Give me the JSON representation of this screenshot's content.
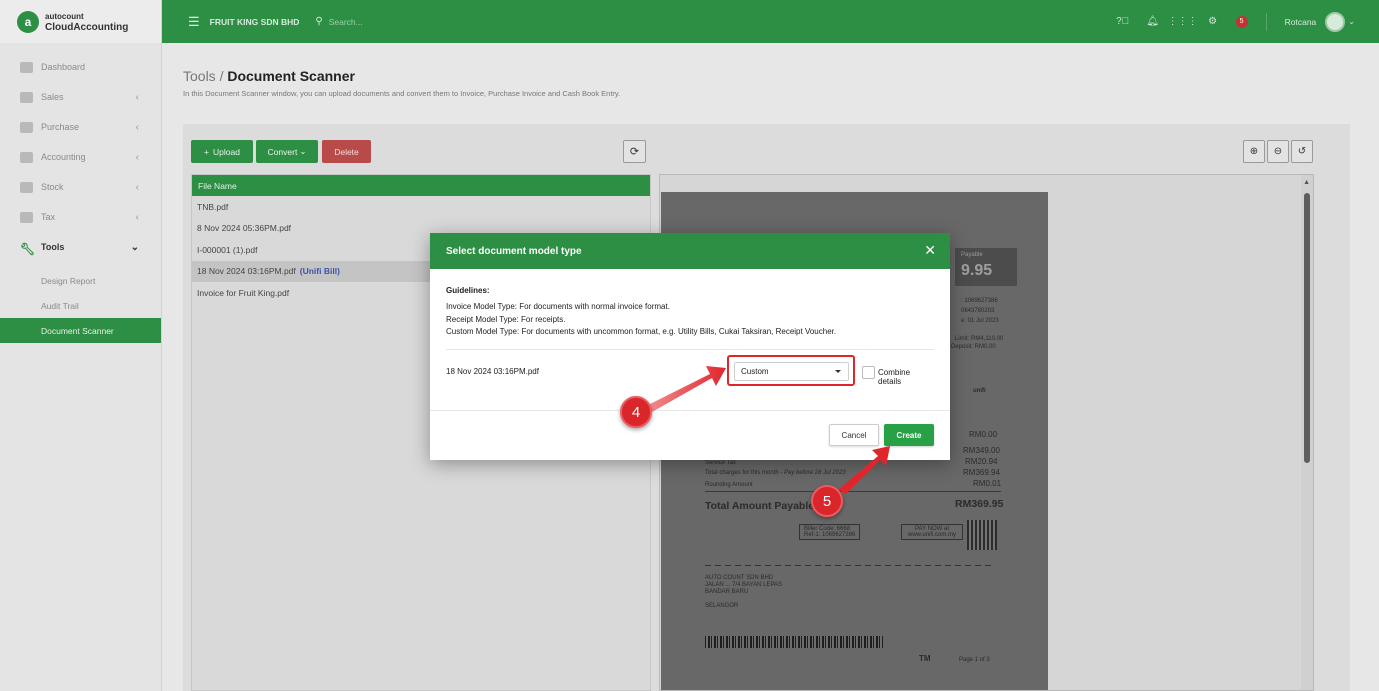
{
  "brand": {
    "logo_letter": "a",
    "sub": "autocount",
    "name": "CloudAccounting"
  },
  "topbar": {
    "company": "FRUIT KING SDN BHD",
    "search_placeholder": "Search...",
    "notification_count": "5",
    "user": "Rotcana"
  },
  "sidebar": {
    "items": [
      {
        "label": "Dashboard"
      },
      {
        "label": "Sales"
      },
      {
        "label": "Purchase"
      },
      {
        "label": "Accounting"
      },
      {
        "label": "Stock"
      },
      {
        "label": "Tax"
      },
      {
        "label": "Tools"
      }
    ],
    "sub_items": [
      {
        "label": "Design Report"
      },
      {
        "label": "Audit Trail"
      },
      {
        "label": "Document Scanner"
      }
    ]
  },
  "page": {
    "crumb": "Tools",
    "title": "Document Scanner",
    "description": "In this Document Scanner window, you can upload documents and convert them to Invoice, Purchase Invoice and Cash Book Entry."
  },
  "toolbar": {
    "upload": "Upload",
    "convert": "Convert",
    "delete": "Delete"
  },
  "file_table": {
    "header": "File Name",
    "rows": [
      {
        "name": "TNB.pdf",
        "tag": ""
      },
      {
        "name": "8 Nov 2024 05:36PM.pdf",
        "tag": ""
      },
      {
        "name": "I-000001 (1).pdf",
        "tag": ""
      },
      {
        "name": "18 Nov 2024 03:16PM.pdf",
        "tag": "(Unifi Bill)"
      },
      {
        "name": "Invoice for Fruit King.pdf",
        "tag": ""
      }
    ]
  },
  "receipt": {
    "payable_label": "Payable",
    "payable_amount": "9.95",
    "acct_1": ": 1069627386",
    "acct_2": "0643780203",
    "acct_3": "e: 01 Jul 2023",
    "limit": "Limit: RM4,110.00",
    "deposit": "Deposit: RM0.00",
    "brand": "unifi",
    "amt_1": "RM0.00",
    "amt_2": "RM349.00",
    "service_tax_label": "Service Tax",
    "service_tax": "RM20.94",
    "total_month_label": "Total charges for this month",
    "total_month_note": "- Pay before 28 Jul 2023",
    "total_month": "RM369.94",
    "rounding_label": "Rounding Amount",
    "rounding": "RM0.01",
    "total_label": "Total Amount Payable",
    "total": "RM369.95",
    "biller": "Biller Code: 6668",
    "ref": "Ref-1: 1069627386",
    "paynow": "PAY NOW at",
    "site": "www.unifi.com.my",
    "addr_1": "AUTO COUNT SDN BHD",
    "addr_2": "JALAN ... 7/4 BAYAN LEPAS",
    "addr_3": "BANDAR BARU",
    "addr_4": "SELANGOR",
    "tm": "TM",
    "page": "Page 1 of 3"
  },
  "modal": {
    "title": "Select document model type",
    "guidelines_title": "Guidelines:",
    "guideline_1": "Invoice Model Type: For documents with normal invoice format.",
    "guideline_2": "Receipt Model Type: For receipts.",
    "guideline_3": "Custom Model Type: For documents with uncommon format, e.g. Utility Bills, Cukai Taksiran, Receipt Voucher.",
    "doc_name": "18 Nov 2024 03:16PM.pdf",
    "model_selected": "Custom",
    "combine_label": "Combine details",
    "combine_checked": false,
    "cancel": "Cancel",
    "create": "Create"
  },
  "annotations": {
    "step_4": "4",
    "step_5": "5"
  },
  "colors": {
    "primary": "#2c8f44",
    "danger": "#b84a4a",
    "annotation": "#d8262b"
  }
}
